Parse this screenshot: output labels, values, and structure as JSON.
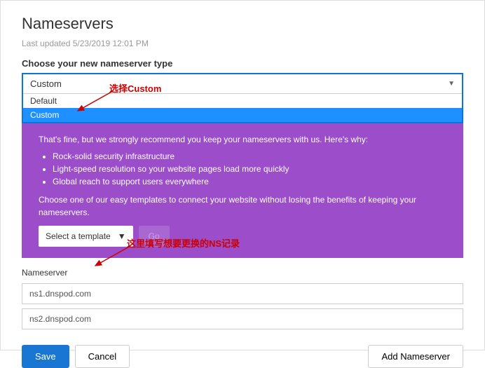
{
  "title": "Nameservers",
  "lastUpdated": "Last updated 5/23/2019 12:01 PM",
  "typeLabel": "Choose your new nameserver type",
  "select": {
    "current": "Custom",
    "options": [
      "Default",
      "Custom"
    ]
  },
  "purple": {
    "intro": "That's fine, but we strongly recommend you keep your nameservers with us. Here's why:",
    "bullets": [
      "Rock-solid security infrastructure",
      "Light-speed resolution so your website pages load more quickly",
      "Global reach to support users everywhere"
    ],
    "choose": "Choose one of our easy templates to connect your website without losing the benefits of keeping your nameservers.",
    "templateBtn": "Select a template",
    "goBtn": "Go"
  },
  "nsLabel": "Nameserver",
  "ns": [
    "ns1.dnspod.com",
    "ns2.dnspod.com"
  ],
  "buttons": {
    "save": "Save",
    "cancel": "Cancel",
    "add": "Add Nameserver"
  },
  "annotations": {
    "selectCustom": "选择Custom",
    "fillNS": "这里填写想要更换的NS记录"
  }
}
